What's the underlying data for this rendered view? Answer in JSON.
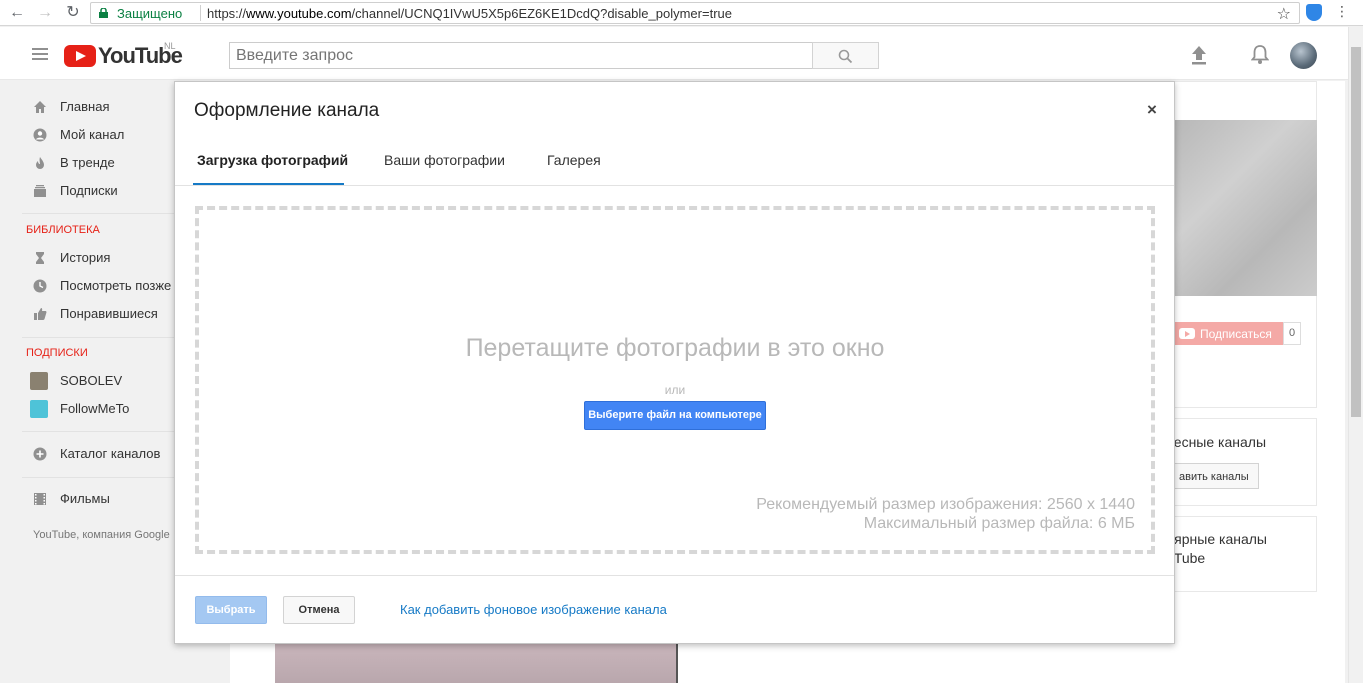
{
  "browser": {
    "secure_label": "Защищено",
    "url_scheme": "https://",
    "url_host": "www.youtube.com",
    "url_path": "/channel/UCNQ1IVwU5X5p6EZ6KE1DcdQ?disable_polymer=true",
    "back_icon": "arrow-left",
    "forward_icon": "arrow-right",
    "reload_icon": "reload",
    "star_icon": "star-outline"
  },
  "header": {
    "logo_text": "YouTube",
    "logo_region": "NL",
    "search_placeholder": "Введите запрос"
  },
  "sidebar": {
    "items": [
      {
        "label": "Главная",
        "icon": "home"
      },
      {
        "label": "Мой канал",
        "icon": "person"
      },
      {
        "label": "В тренде",
        "icon": "flame"
      },
      {
        "label": "Подписки",
        "icon": "subscriptions"
      }
    ],
    "library_heading": "БИБЛИОТЕКА",
    "library": [
      {
        "label": "История",
        "icon": "hourglass"
      },
      {
        "label": "Посмотреть позже",
        "icon": "clock"
      },
      {
        "label": "Понравившиеся",
        "icon": "thumbs-up"
      }
    ],
    "subscriptions_heading": "ПОДПИСКИ",
    "subscriptions": [
      {
        "label": "SOBOLEV"
      },
      {
        "label": "FollowMeTo"
      }
    ],
    "catalog": "Каталог каналов",
    "movies": "Фильмы",
    "footer": "YouTube, компания Google"
  },
  "channel_page": {
    "subscribe_label": "Подписаться",
    "subscriber_count": "0",
    "interesting_channels": "ресные каналы",
    "add_channels_btn": "авить каналы",
    "popular_channels_line1": "лярные каналы",
    "popular_channels_line2": "uTube"
  },
  "dialog": {
    "title": "Оформление канала",
    "close_label": "×",
    "tabs": [
      {
        "label": "Загрузка фотографий",
        "active": true
      },
      {
        "label": "Ваши фотографии",
        "active": false
      },
      {
        "label": "Галерея",
        "active": false
      }
    ],
    "drop_title": "Перетащите фотографии в это окно",
    "drop_or": "или",
    "choose_file": "Выберите файл на компьютере",
    "recommended_size": "Рекомендуемый размер изображения: 2560 x 1440",
    "max_file_size": "Максимальный размер файла: 6 МБ",
    "select_btn": "Выбрать",
    "cancel_btn": "Отмена",
    "help_link": "Как добавить фоновое изображение канала"
  },
  "colors": {
    "youtube_red": "#e62117",
    "link_blue": "#167ac6",
    "primary_blue": "#4285f4",
    "secure_green": "#0b8043"
  }
}
